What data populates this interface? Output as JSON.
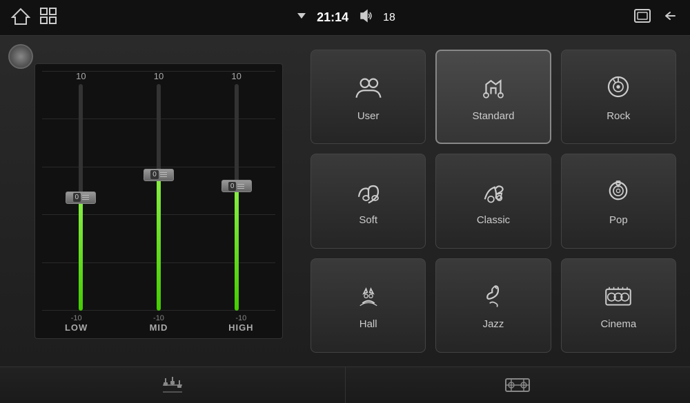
{
  "statusBar": {
    "time": "21:14",
    "volume": "18",
    "homeIcon": "⌂",
    "gridIcon": "⊞",
    "signalIcon": "▽",
    "speakerIcon": "🔊",
    "windowIcon": "⬜",
    "backIcon": "↩"
  },
  "eq": {
    "bands": [
      {
        "label": "LOW",
        "topValue": "10",
        "bottomValue": "-10",
        "currentValue": "0",
        "fillPercent": 50
      },
      {
        "label": "MID",
        "topValue": "10",
        "bottomValue": "-10",
        "currentValue": "0",
        "fillPercent": 60
      },
      {
        "label": "HIGH",
        "topValue": "10",
        "bottomValue": "-10",
        "currentValue": "0",
        "fillPercent": 55
      }
    ]
  },
  "presets": [
    {
      "id": "user",
      "label": "User",
      "active": false
    },
    {
      "id": "standard",
      "label": "Standard",
      "active": true
    },
    {
      "id": "rock",
      "label": "Rock",
      "active": false
    },
    {
      "id": "soft",
      "label": "Soft",
      "active": false
    },
    {
      "id": "classic",
      "label": "Classic",
      "active": false
    },
    {
      "id": "pop",
      "label": "Pop",
      "active": false
    },
    {
      "id": "hall",
      "label": "Hall",
      "active": false
    },
    {
      "id": "jazz",
      "label": "Jazz",
      "active": false
    },
    {
      "id": "cinema",
      "label": "Cinema",
      "active": false
    }
  ],
  "bottomBar": {
    "eqIcon": "EQ",
    "targetIcon": "TGT"
  }
}
